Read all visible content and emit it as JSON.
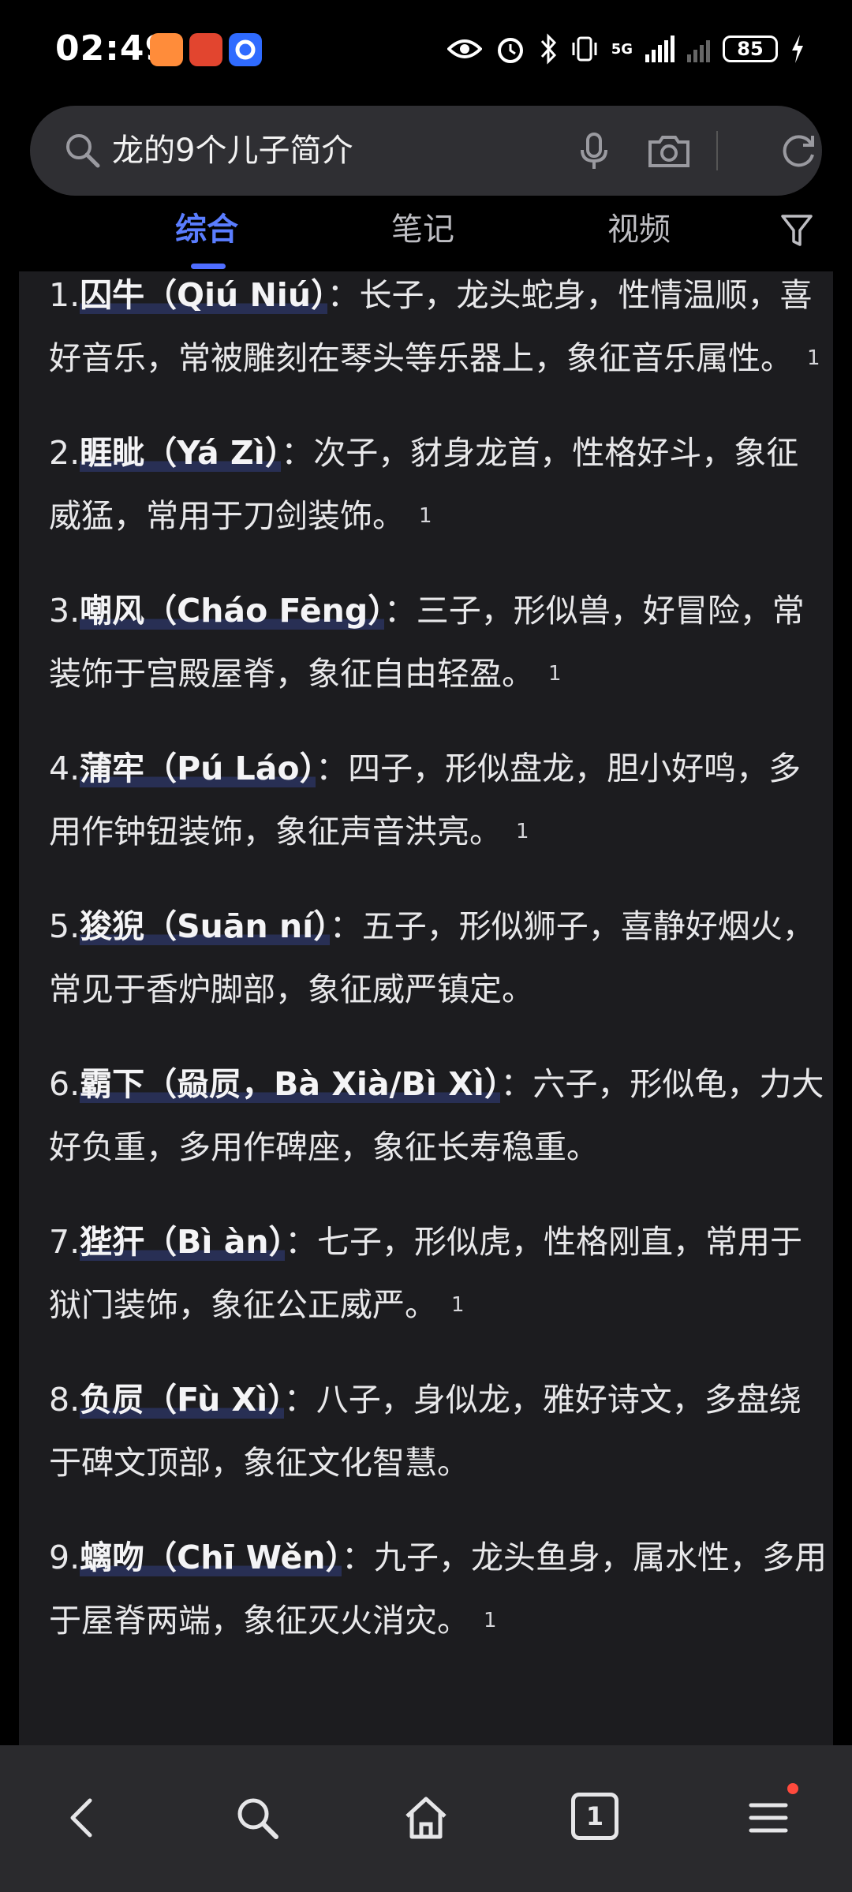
{
  "status_bar": {
    "time": "02:49",
    "network": "5G",
    "battery": "85"
  },
  "search": {
    "query": "龙的9个儿子简介",
    "icons": [
      "search-icon",
      "mic-icon",
      "camera-icon",
      "refresh-icon"
    ]
  },
  "tabs": [
    {
      "label": "综合",
      "active": true
    },
    {
      "label": "笔记",
      "active": false
    },
    {
      "label": "视频",
      "active": false
    }
  ],
  "results": [
    {
      "num": "1.",
      "name": "囚牛（Qiú Niú）",
      "desc": "：长子，龙头蛇身，性情温顺，喜好音乐，常被雕刻在琴头等乐器上，象征音乐属性。",
      "cite": "1"
    },
    {
      "num": "2.",
      "name": "睚眦（Yá Zì）",
      "desc": "：次子，豺身龙首，性格好斗，象征威猛，常用于刀剑装饰。",
      "cite": "1"
    },
    {
      "num": "3.",
      "name": "嘲风（Cháo Fēng）",
      "desc": "：三子，形似兽，好冒险，常装饰于宫殿屋脊，象征自由轻盈。",
      "cite": "1"
    },
    {
      "num": "4.",
      "name": "蒲牢（Pú Láo）",
      "desc": "：四子，形似盘龙，胆小好鸣，多用作钟钮装饰，象征声音洪亮。",
      "cite": "1"
    },
    {
      "num": "5.",
      "name": "狻猊（Suān ní）",
      "desc": "：五子，形似狮子，喜静好烟火，常见于香炉脚部，象征威严镇定。",
      "cite": ""
    },
    {
      "num": "6.",
      "name": "霸下（赑屃，Bà Xià/Bì Xì）",
      "desc": "：六子，形似龟，力大好负重，多用作碑座，象征长寿稳重。",
      "cite": ""
    },
    {
      "num": "7.",
      "name": "狴犴（Bì àn）",
      "desc": "：七子，形似虎，性格刚直，常用于狱门装饰，象征公正威严。",
      "cite": "1"
    },
    {
      "num": "8.",
      "name": "负屃（Fù Xì）",
      "desc": "：八子，身似龙，雅好诗文，多盘绕于碑文顶部，象征文化智慧。",
      "cite": ""
    },
    {
      "num": "9.",
      "name": "螭吻（Chī Wěn）",
      "desc": "：九子，龙头鱼身，属水性，多用于屋脊两端，象征灭火消灾。",
      "cite": "1"
    }
  ],
  "bottom_nav": {
    "tab_count": "1",
    "icons": [
      "back-icon",
      "search-icon",
      "home-icon",
      "tabs-icon",
      "menu-icon"
    ]
  },
  "colors": {
    "accent": "#4f6dff",
    "background": "#000000",
    "card": "#1c1c1f",
    "notification_dot": "#ff4a3d"
  }
}
